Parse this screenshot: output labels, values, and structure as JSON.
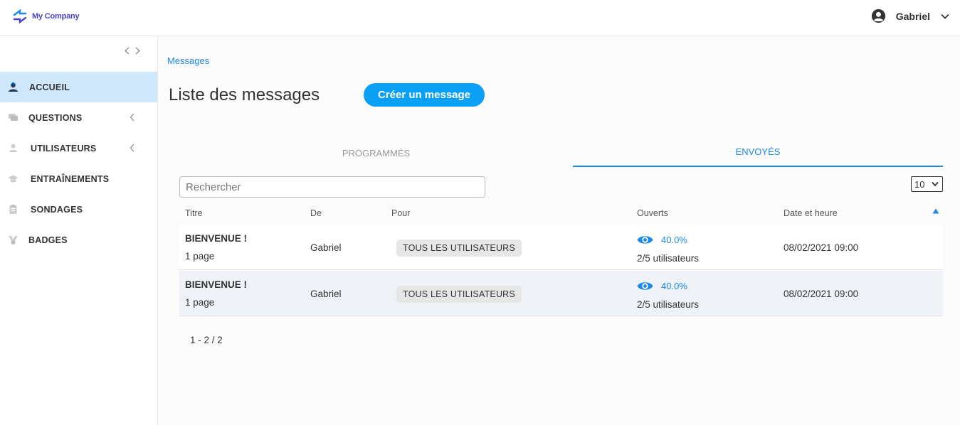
{
  "header": {
    "company_name": "My Company",
    "user_name": "Gabriel"
  },
  "sidebar": {
    "items": [
      {
        "label": "ACCUEIL",
        "icon": "home-user-icon",
        "active": true
      },
      {
        "label": "QUESTIONS",
        "icon": "chat-icon",
        "has_arrow": true
      },
      {
        "label": "UTILISATEURS",
        "icon": "user-icon",
        "has_arrow": true
      },
      {
        "label": "ENTRAÎNEMENTS",
        "icon": "graduation-cap-icon"
      },
      {
        "label": "SONDAGES",
        "icon": "clipboard-icon"
      },
      {
        "label": "BADGES",
        "icon": "badge-icon"
      }
    ]
  },
  "main": {
    "breadcrumb": "Messages",
    "title": "Liste des messages",
    "create_button": "Créer un message",
    "tabs": [
      {
        "label": "PROGRAMMÉS",
        "active": false
      },
      {
        "label": "ENVOYÉS",
        "active": true
      }
    ],
    "search_placeholder": "Rechercher",
    "per_page": "10",
    "columns": [
      "Titre",
      "De",
      "Pour",
      "Ouverts",
      "Date et heure"
    ],
    "rows": [
      {
        "title": "BIENVENUE !",
        "pages": "1 page",
        "from": "Gabriel",
        "to": "TOUS LES UTILISATEURS",
        "open_pct": "40.0%",
        "open_users": "2/5 utilisateurs",
        "datetime": "08/02/2021 09:00"
      },
      {
        "title": "BIENVENUE !",
        "pages": "1 page",
        "from": "Gabriel",
        "to": "TOUS LES UTILISATEURS",
        "open_pct": "40.0%",
        "open_users": "2/5 utilisateurs",
        "datetime": "08/02/2021 09:00"
      }
    ],
    "pagination": "1 - 2 / 2"
  },
  "colors": {
    "accent": "#1e88e5",
    "button": "#0aa0f5",
    "active_nav": "#cfe8fb",
    "logo_text": "#4b44c8"
  }
}
